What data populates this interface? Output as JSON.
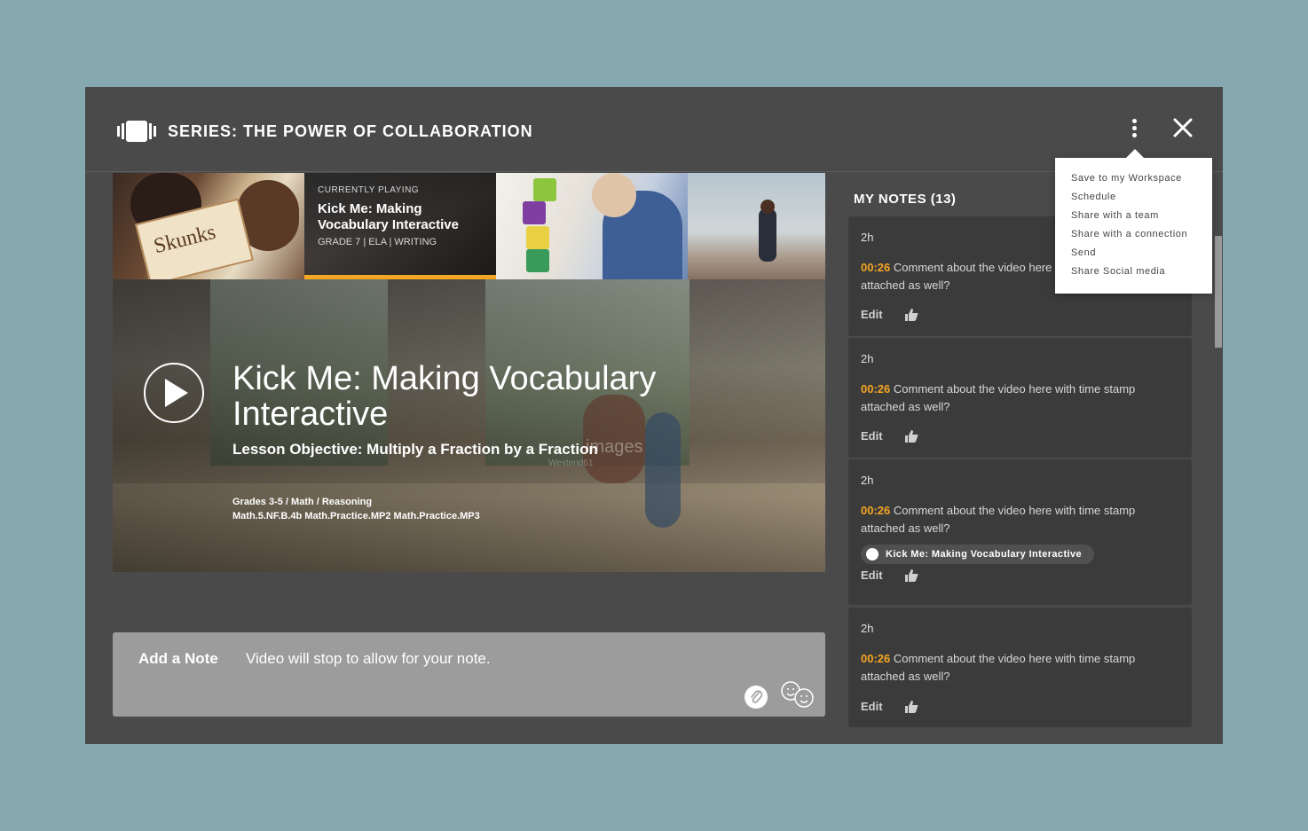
{
  "header": {
    "series_title": "SERIES: THE POWER OF COLLABORATION"
  },
  "strip": {
    "thumb1_text": "Skunks",
    "current": {
      "label": "CURRENTLY PLAYING",
      "title": "Kick Me: Making Vocabulary Interactive",
      "sub": "GRADE 7 | ELA | WRITING"
    }
  },
  "hero": {
    "title": "Kick Me: Making Vocabulary Interactive",
    "objective": "Lesson Objective: Multiply a Fraction by a Fraction",
    "watermark": "images",
    "watermark_small": "Westend61",
    "meta_line1": "Grades 3-5 / Math / Reasoning",
    "meta_line2": "Math.5.NF.B.4b Math.Practice.MP2 Math.Practice.MP3"
  },
  "note_input": {
    "label": "Add a Note",
    "placeholder": "Video will stop to allow for your note."
  },
  "notes": {
    "title": "MY NOTES (13)",
    "items": [
      {
        "time": "2h",
        "stamp": "00:26",
        "text": "Comment about the video here with time stamp attached as well?",
        "edit": "Edit"
      },
      {
        "time": "2h",
        "stamp": "00:26",
        "text": "Comment about the video here with time stamp attached as well?",
        "edit": "Edit"
      },
      {
        "time": "2h",
        "stamp": "00:26",
        "text": "Comment about the video here with time stamp attached as well?",
        "attachment": "Kick Me: Making Vocabulary Interactive",
        "edit": "Edit"
      },
      {
        "time": "2h",
        "stamp": "00:26",
        "text": "Comment about the video here with time stamp attached as well?",
        "edit": "Edit"
      }
    ]
  },
  "menu": {
    "items": [
      "Save to my Workspace",
      "Schedule",
      "Share with a team",
      "Share with a connection",
      "Send",
      "Share Social media"
    ]
  },
  "colors": {
    "background": "#86a9b0",
    "panel": "#4a4a4a",
    "card": "#3b3b3b",
    "accent": "#f5a623"
  },
  "icons": [
    "series-icon",
    "more-options-icon",
    "close-icon",
    "chevron-right-icon",
    "play-icon",
    "paperclip-icon",
    "emoji-icon",
    "thumbs-up-icon"
  ]
}
